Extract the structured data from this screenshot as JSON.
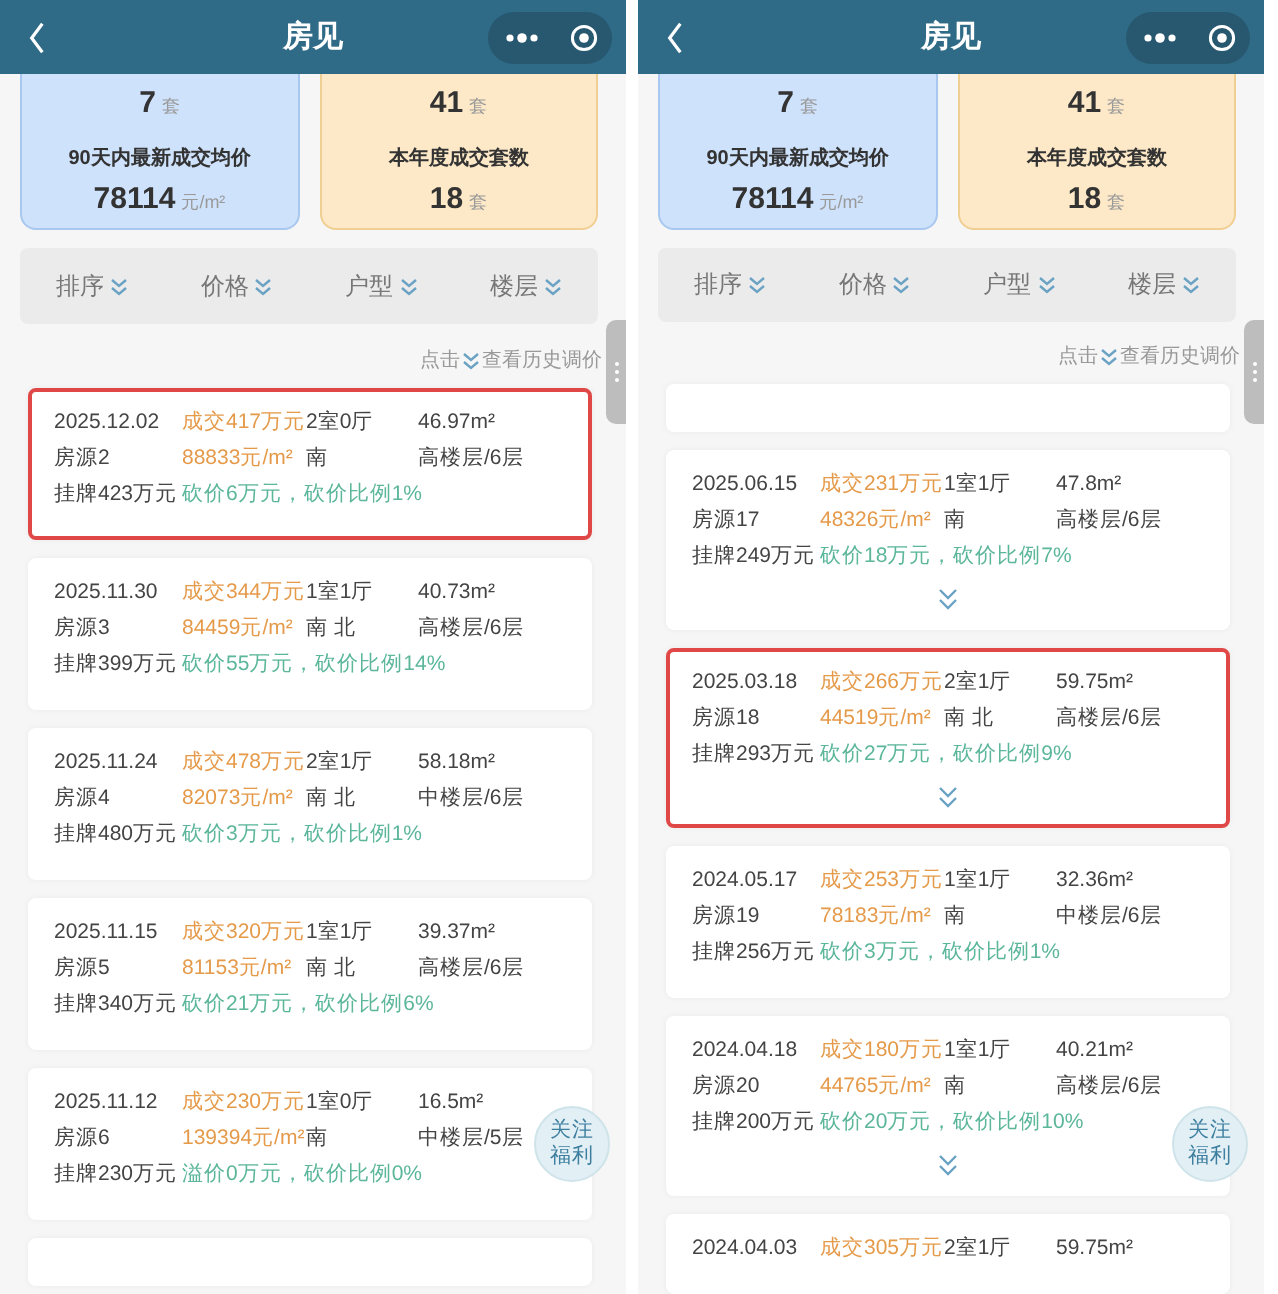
{
  "panels": [
    {
      "title": "房见",
      "stats": [
        {
          "top_value": "7",
          "top_unit": "套",
          "label": "90天内最新成交均价",
          "value": "78114",
          "unit": "元/m²",
          "color": "#cfe2fb"
        },
        {
          "top_value": "41",
          "top_unit": "套",
          "label": "本年度成交套数",
          "value": "18",
          "unit": "套",
          "color": "#fde9c8"
        }
      ],
      "filters": [
        "排序",
        "价格",
        "户型",
        "楼层"
      ],
      "hint": {
        "prefix": "点击",
        "suffix": "查看历史调价"
      },
      "records": [
        {
          "date": "2025.12.02",
          "deal": "成交417万元",
          "layout": "2室0厅",
          "area": "46.97m²",
          "source": "房源2",
          "unit_price": "88833元/m²",
          "orientation": "南",
          "floor": "高楼层/6层",
          "listing": "挂牌423万元",
          "discount": "砍价6万元，砍价比例1%",
          "highlighted": true,
          "expandable": false
        },
        {
          "date": "2025.11.30",
          "deal": "成交344万元",
          "layout": "1室1厅",
          "area": "40.73m²",
          "source": "房源3",
          "unit_price": "84459元/m²",
          "orientation": "南 北",
          "floor": "高楼层/6层",
          "listing": "挂牌399万元",
          "discount": "砍价55万元，砍价比例14%",
          "highlighted": false,
          "expandable": false
        },
        {
          "date": "2025.11.24",
          "deal": "成交478万元",
          "layout": "2室1厅",
          "area": "58.18m²",
          "source": "房源4",
          "unit_price": "82073元/m²",
          "orientation": "南 北",
          "floor": "中楼层/6层",
          "listing": "挂牌480万元",
          "discount": "砍价3万元，砍价比例1%",
          "highlighted": false,
          "expandable": false
        },
        {
          "date": "2025.11.15",
          "deal": "成交320万元",
          "layout": "1室1厅",
          "area": "39.37m²",
          "source": "房源5",
          "unit_price": "81153元/m²",
          "orientation": "南 北",
          "floor": "高楼层/6层",
          "listing": "挂牌340万元",
          "discount": "砍价21万元，砍价比例6%",
          "highlighted": false,
          "expandable": false
        },
        {
          "date": "2025.11.12",
          "deal": "成交230万元",
          "layout": "1室0厅",
          "area": "16.5m²",
          "source": "房源6",
          "unit_price": "139394元/m²",
          "orientation": "南",
          "floor": "中楼层/5层",
          "listing": "挂牌230万元",
          "discount": "溢价0万元，砍价比例0%",
          "highlighted": false,
          "expandable": false
        },
        {
          "kind": "stub"
        }
      ],
      "fab": "关注福利"
    },
    {
      "title": "房见",
      "stats": [
        {
          "top_value": "7",
          "top_unit": "套",
          "label": "90天内最新成交均价",
          "value": "78114",
          "unit": "元/m²",
          "color": "#cfe2fb"
        },
        {
          "top_value": "41",
          "top_unit": "套",
          "label": "本年度成交套数",
          "value": "18",
          "unit": "套",
          "color": "#fde9c8"
        }
      ],
      "filters": [
        "排序",
        "价格",
        "户型",
        "楼层"
      ],
      "hint": {
        "prefix": "点击",
        "suffix": "查看历史调价"
      },
      "records": [
        {
          "kind": "stub"
        },
        {
          "date": "2025.06.15",
          "deal": "成交231万元",
          "layout": "1室1厅",
          "area": "47.8m²",
          "source": "房源17",
          "unit_price": "48326元/m²",
          "orientation": "南",
          "floor": "高楼层/6层",
          "listing": "挂牌249万元",
          "discount": "砍价18万元，砍价比例7%",
          "highlighted": false,
          "expandable": true
        },
        {
          "date": "2025.03.18",
          "deal": "成交266万元",
          "layout": "2室1厅",
          "area": "59.75m²",
          "source": "房源18",
          "unit_price": "44519元/m²",
          "orientation": "南 北",
          "floor": "高楼层/6层",
          "listing": "挂牌293万元",
          "discount": "砍价27万元，砍价比例9%",
          "highlighted": true,
          "expandable": true
        },
        {
          "date": "2024.05.17",
          "deal": "成交253万元",
          "layout": "1室1厅",
          "area": "32.36m²",
          "source": "房源19",
          "unit_price": "78183元/m²",
          "orientation": "南",
          "floor": "中楼层/6层",
          "listing": "挂牌256万元",
          "discount": "砍价3万元，砍价比例1%",
          "highlighted": false,
          "expandable": false
        },
        {
          "date": "2024.04.18",
          "deal": "成交180万元",
          "layout": "1室1厅",
          "area": "40.21m²",
          "source": "房源20",
          "unit_price": "44765元/m²",
          "orientation": "南",
          "floor": "高楼层/6层",
          "listing": "挂牌200万元",
          "discount": "砍价20万元，砍价比例10%",
          "highlighted": false,
          "expandable": true
        },
        {
          "date": "2024.04.03",
          "deal": "成交305万元",
          "layout": "2室1厅",
          "area": "59.75m²",
          "highlighted": false,
          "expandable": false
        }
      ],
      "fab": "关注福利"
    }
  ]
}
